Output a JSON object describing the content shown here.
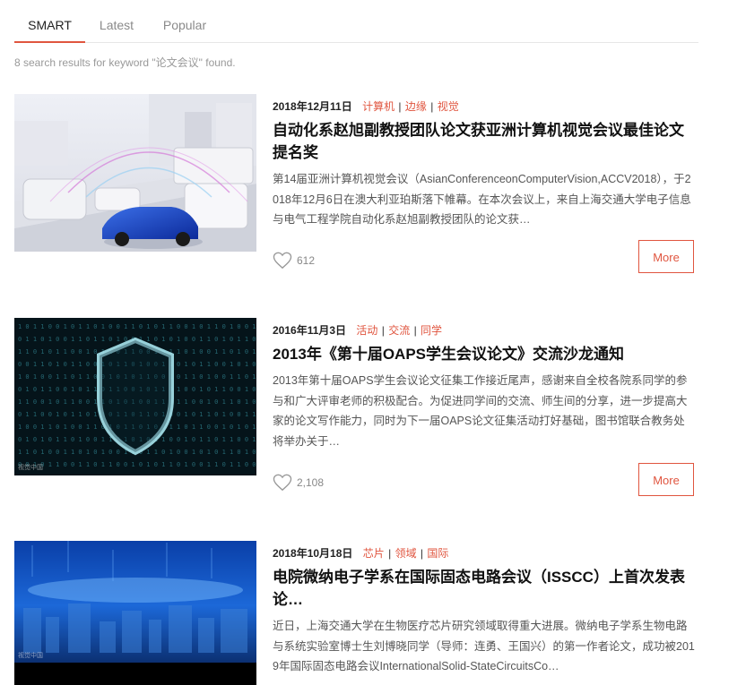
{
  "tabs": [
    {
      "label": "SMART",
      "active": true
    },
    {
      "label": "Latest",
      "active": false
    },
    {
      "label": "Popular",
      "active": false
    }
  ],
  "summary": "8 search results for keyword \"论文会议\" found.",
  "colors": {
    "accent": "#e0553f",
    "tab_underline": "#e0553f",
    "muted": "#999999"
  },
  "items": [
    {
      "date": "2018年12月11日",
      "tags": [
        "计算机",
        "边缘",
        "视觉"
      ],
      "title": "自动化系赵旭副教授团队论文获亚洲计算机视觉会议最佳论文提名奖",
      "description": "第14届亚洲计算机视觉会议（AsianConferenceonComputerVision,ACCV2018），于2018年12月6日在澳大利亚珀斯落下帷幕。在本次会议上，来自上海交通大学电子信息与电气工程学院自动化系赵旭副教授团队的论文获…",
      "likes": "612",
      "more_label": "More",
      "image": "autonomous-cars-sensing-illustration"
    },
    {
      "date": "2016年11月3日",
      "tags": [
        "活动",
        "交流",
        "同学"
      ],
      "title": "2013年《第十届OAPS学生会议论文》交流沙龙通知",
      "description": "2013年第十届OAPS学生会议论文征集工作接近尾声，感谢来自全校各院系同学的参与和广大评审老师的积极配合。为促进同学间的交流、师生间的分享，进一步提高大家的论文写作能力，同时为下一届OAPS论文征集活动打好基础，图书馆联合教务处将举办关于…",
      "likes": "2,108",
      "more_label": "More",
      "image": "digital-shield-matrix",
      "watermark": "视觉中国"
    },
    {
      "date": "2018年10月18日",
      "tags": [
        "芯片",
        "领域",
        "国际"
      ],
      "title": "电院微纳电子学系在国际固态电路会议（ISSCC）上首次发表论…",
      "description": "近日，上海交通大学在生物医疗芯片研究领域取得重大进展。微纳电子学系生物电路与系统实验室博士生刘博晓同学（导师：连勇、王国兴）的第一作者论文，成功被2019年国际固态电路会议InternationalSolid-StateCircuitsCo…",
      "image": "blue-digital-city",
      "watermark": "视觉中国"
    }
  ]
}
